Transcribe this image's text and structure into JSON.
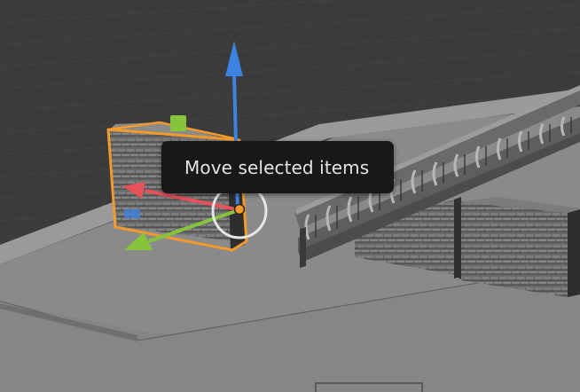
{
  "tooltip": {
    "text": "Move selected items"
  },
  "scene": {
    "tool": "move",
    "gizmo_axes": [
      "x-axis-red",
      "y-axis-green",
      "z-axis-blue"
    ],
    "colors": {
      "background": "#3b3b3b",
      "grid": "#4a4a4a",
      "floor": "#8c8c8c",
      "selection_outline": "#f29a2b",
      "axis_x": "#e8505a",
      "axis_y": "#86c43c",
      "axis_z": "#3c82e0",
      "tooltip_bg": "#181818",
      "tooltip_text": "#e4e4e4"
    }
  }
}
